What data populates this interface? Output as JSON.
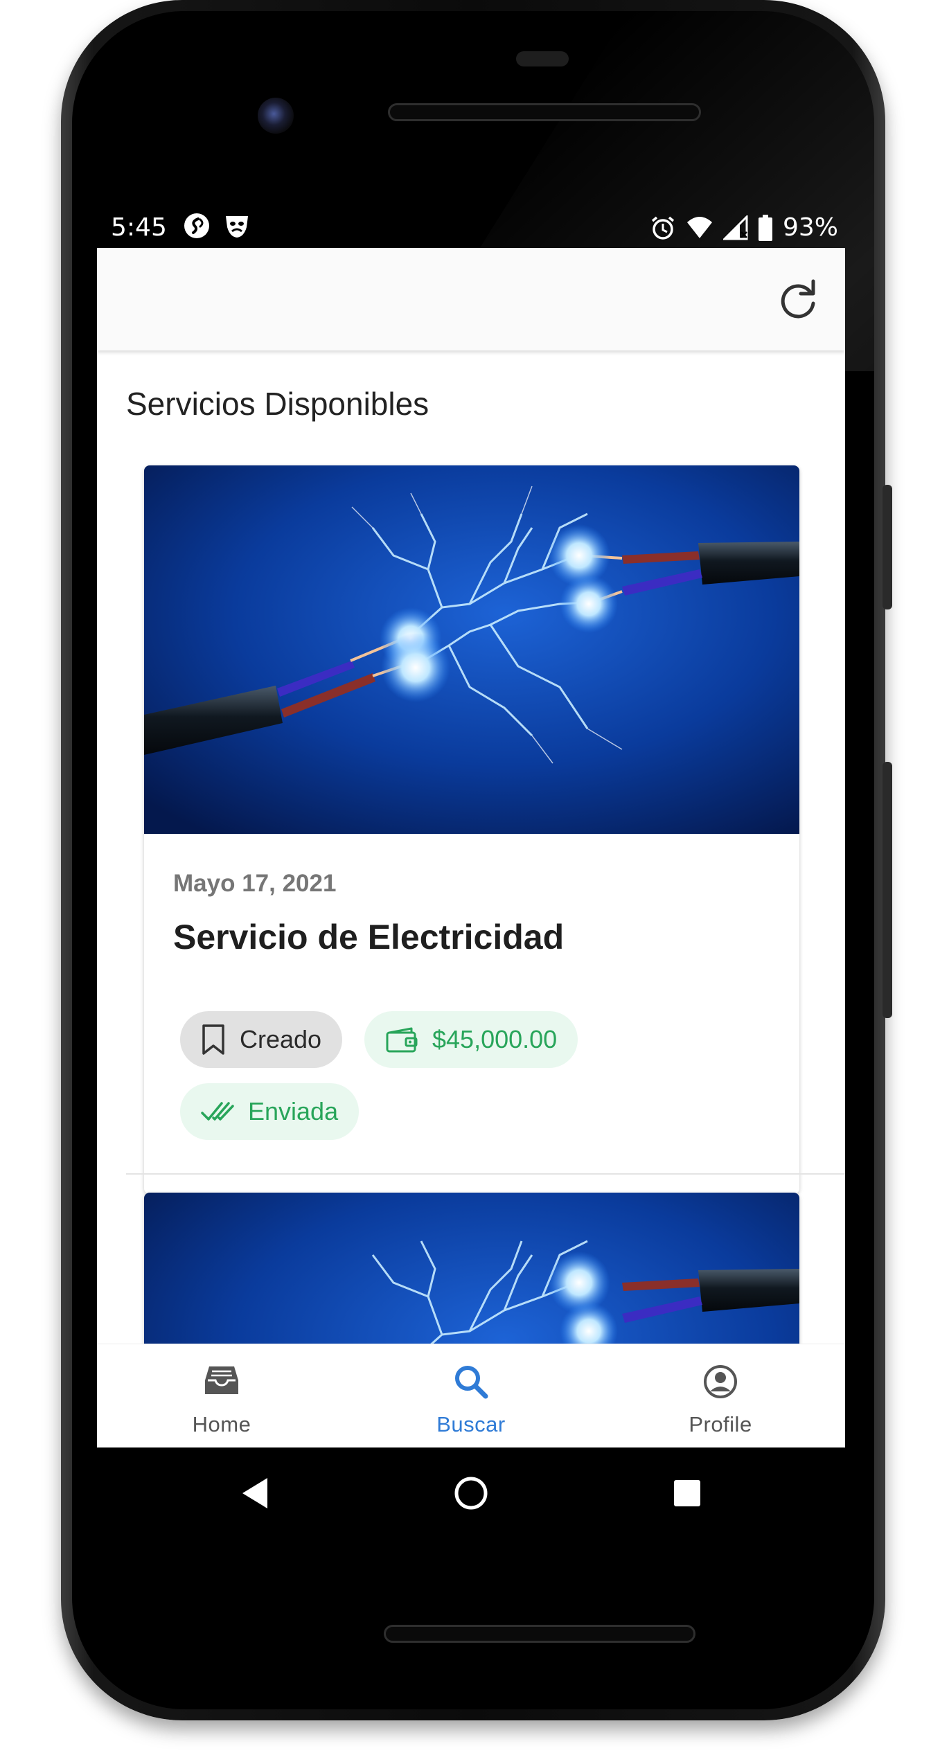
{
  "status_bar": {
    "time": "5:45",
    "battery": "93%",
    "left_icons": [
      "shazam-icon",
      "mask-icon"
    ],
    "right_icons": [
      "alarm-icon",
      "wifi-icon",
      "signal-icon",
      "battery-icon"
    ]
  },
  "app_bar": {
    "action_icon": "refresh-icon"
  },
  "section": {
    "title": "Servicios Disponibles"
  },
  "cards": [
    {
      "image": "electric-cables-sparks",
      "date": "Mayo 17, 2021",
      "title": "Servicio de Electricidad",
      "chips": {
        "status": "Creado",
        "price": "$45,000.00",
        "sent": "Enviada"
      }
    },
    {
      "image": "electric-cables-sparks"
    }
  ],
  "bottom_nav": {
    "items": [
      {
        "label": "Home",
        "icon": "inbox-icon",
        "active": false
      },
      {
        "label": "Buscar",
        "icon": "search-icon",
        "active": true
      },
      {
        "label": "Profile",
        "icon": "account-circle-icon",
        "active": false
      }
    ],
    "active_color": "#2f7bd6",
    "inactive_color": "#555555"
  },
  "colors": {
    "chip_green_text": "#28a55a",
    "chip_green_bg": "#e9f8ef",
    "chip_grey_bg": "#e1e1e1"
  }
}
